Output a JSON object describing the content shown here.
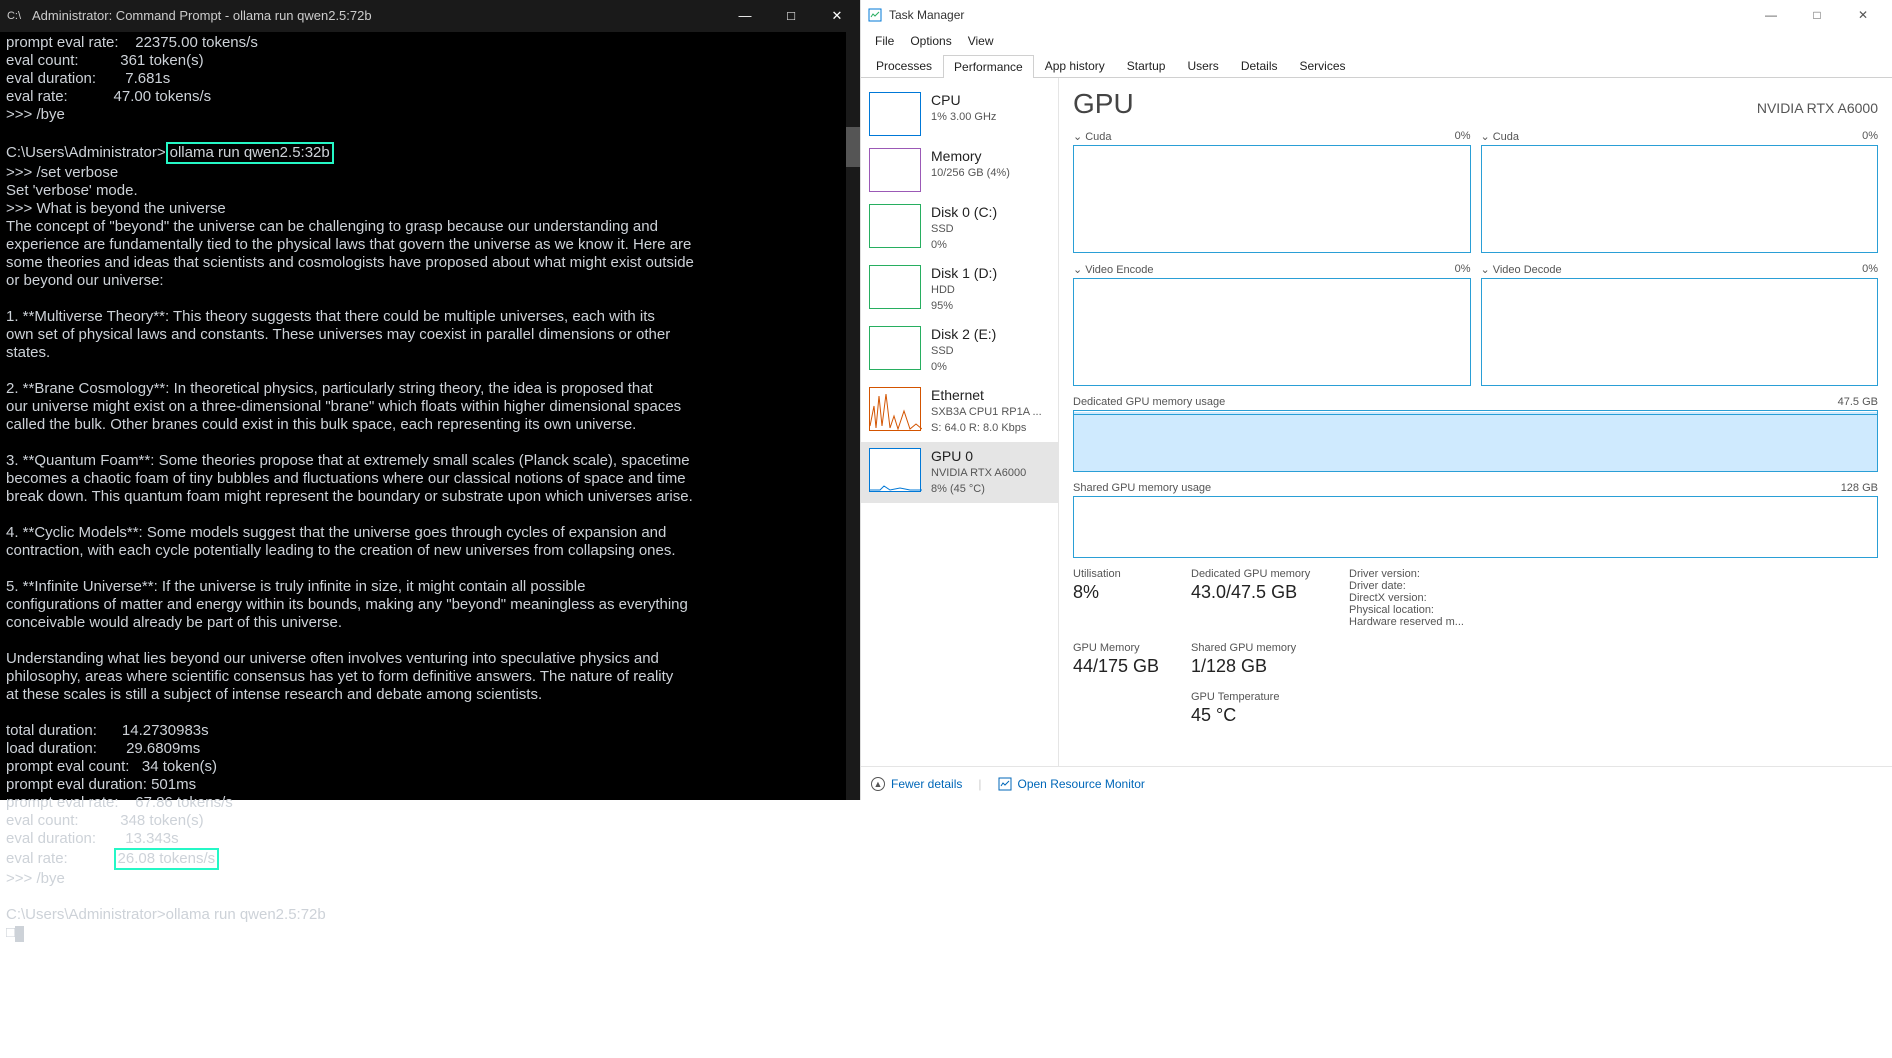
{
  "cmd": {
    "title": "Administrator: Command Prompt - ollama  run qwen2.5:72b",
    "lines_pre": "prompt eval rate:    22375.00 tokens/s\neval count:          361 token(s)\neval duration:       7.681s\neval rate:           47.00 tokens/s\n>>> /bye\n\nC:\\Users\\Administrator>",
    "boxed1": "ollama run qwen2.5:32b",
    "body_main": "\n>>> /set verbose\nSet 'verbose' mode.\n>>> What is beyond the universe\nThe concept of \"beyond\" the universe can be challenging to grasp because our understanding and\nexperience are fundamentally tied to the physical laws that govern the universe as we know it. Here are\nsome theories and ideas that scientists and cosmologists have proposed about what might exist outside\nor beyond our universe:\n\n1. **Multiverse Theory**: This theory suggests that there could be multiple universes, each with its\nown set of physical laws and constants. These universes may coexist in parallel dimensions or other\nstates.\n\n2. **Brane Cosmology**: In theoretical physics, particularly string theory, the idea is proposed that\nour universe might exist on a three-dimensional \"brane\" which floats within higher dimensional spaces\ncalled the bulk. Other branes could exist in this bulk space, each representing its own universe.\n\n3. **Quantum Foam**: Some theories propose that at extremely small scales (Planck scale), spacetime\nbecomes a chaotic foam of tiny bubbles and fluctuations where our classical notions of space and time\nbreak down. This quantum foam might represent the boundary or substrate upon which universes arise.\n\n4. **Cyclic Models**: Some models suggest that the universe goes through cycles of expansion and\ncontraction, with each cycle potentially leading to the creation of new universes from collapsing ones.\n\n5. **Infinite Universe**: If the universe is truly infinite in size, it might contain all possible\nconfigurations of matter and energy within its bounds, making any \"beyond\" meaningless as everything\nconceivable would already be part of this universe.\n\nUnderstanding what lies beyond our universe often involves venturing into speculative physics and\nphilosophy, areas where scientific consensus has yet to form definitive answers. The nature of reality\nat these scales is still a subject of intense research and debate among scientists.\n\ntotal duration:      14.2730983s\nload duration:       29.6809ms\nprompt eval count:   34 token(s)\nprompt eval duration: 501ms\nprompt eval rate:    67.86 tokens/s\neval count:          348 token(s)\neval duration:       13.343s\neval rate:           ",
    "boxed2": "26.08 tokens/s",
    "body_post": "\n>>> /bye\n\nC:\\Users\\Administrator>ollama run qwen2.5:72b\n"
  },
  "tm": {
    "title": "Task Manager",
    "menus": [
      "File",
      "Options",
      "View"
    ],
    "tabs": [
      "Processes",
      "Performance",
      "App history",
      "Startup",
      "Users",
      "Details",
      "Services"
    ],
    "active_tab": 1,
    "sidebar": [
      {
        "title": "CPU",
        "sub": "1%  3.00 GHz",
        "cls": ""
      },
      {
        "title": "Memory",
        "sub": "10/256 GB (4%)",
        "cls": "mem"
      },
      {
        "title": "Disk 0 (C:)",
        "sub": "SSD\n0%",
        "cls": "disk"
      },
      {
        "title": "Disk 1 (D:)",
        "sub": "HDD\n95%",
        "cls": "disk"
      },
      {
        "title": "Disk 2 (E:)",
        "sub": "SSD\n0%",
        "cls": "disk"
      },
      {
        "title": "Ethernet",
        "sub": "SXB3A CPU1 RP1A ...\nS: 64.0  R: 8.0 Kbps",
        "cls": "net"
      },
      {
        "title": "GPU 0",
        "sub": "NVIDIA RTX A6000\n8%  (45 °C)",
        "cls": "",
        "selected": true
      }
    ],
    "main": {
      "heading": "GPU",
      "subheading": "NVIDIA RTX A6000",
      "quads": [
        {
          "name": "Cuda",
          "pct": "0%"
        },
        {
          "name": "Cuda",
          "pct": "0%"
        },
        {
          "name": "Video Encode",
          "pct": "0%"
        },
        {
          "name": "Video Decode",
          "pct": "0%"
        }
      ],
      "dedicated": {
        "label": "Dedicated GPU memory usage",
        "right": "47.5 GB"
      },
      "shared": {
        "label": "Shared GPU memory usage",
        "right": "128 GB"
      },
      "stats": {
        "util_l": "Utilisation",
        "util_v": "8%",
        "ded_l": "Dedicated GPU memory",
        "ded_v": "43.0/47.5 GB",
        "drv_l": "Driver version:",
        "gmem_l": "GPU Memory",
        "gmem_v": "44/175 GB",
        "shm_l": "Shared GPU memory",
        "shm_v": "1/128 GB",
        "drvdate_l": "Driver date:",
        "dx_l": "DirectX version:",
        "phy_l": "Physical location:",
        "hw_l": "Hardware reserved m...",
        "temp_l": "GPU Temperature",
        "temp_v": "45 °C"
      }
    },
    "footer": {
      "fewer": "Fewer details",
      "res": "Open Resource Monitor"
    }
  }
}
